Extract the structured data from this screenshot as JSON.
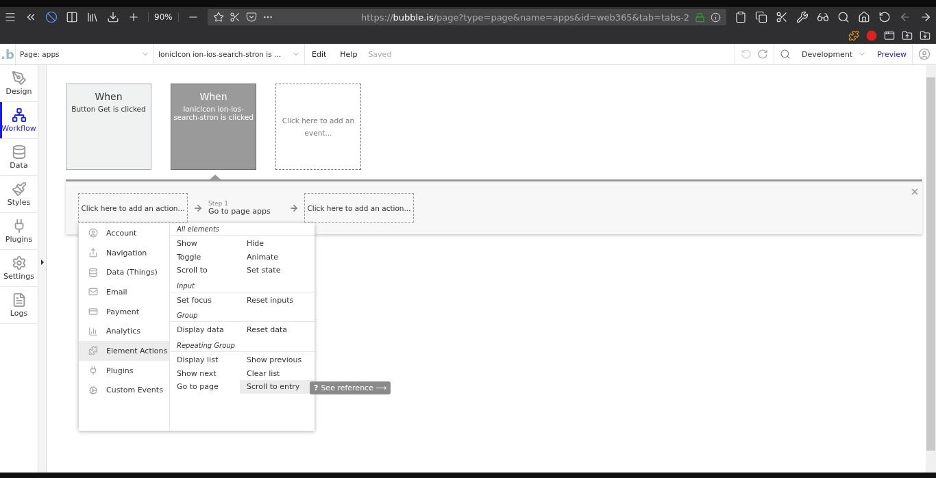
{
  "browser": {
    "zoom": "90%",
    "url_prefix": "https://",
    "url_host": "bubble.is",
    "url_path": "/page?type=page&name=apps&id=web365&tab=tabs-2"
  },
  "header": {
    "logo": ".b",
    "page_selector": "Page: apps",
    "element_selector": "IonicIcon ion-ios-search-stron is ...",
    "menu": [
      "Edit",
      "Help"
    ],
    "status": "Saved",
    "environment": "Development",
    "preview": "Preview"
  },
  "sidebar": {
    "items": [
      {
        "label": "Design",
        "selected": false
      },
      {
        "label": "Workflow",
        "selected": true
      },
      {
        "label": "Data",
        "selected": false
      },
      {
        "label": "Styles",
        "selected": false
      },
      {
        "label": "Plugins",
        "selected": false
      },
      {
        "label": "Settings",
        "selected": false
      },
      {
        "label": "Logs",
        "selected": false
      }
    ]
  },
  "events": [
    {
      "kind": "event",
      "title": "When",
      "description": "Button Get is clicked",
      "selected": false
    },
    {
      "kind": "event",
      "title": "When",
      "description": "IonicIcon ion-ios-search-stron is clicked",
      "selected": true
    },
    {
      "kind": "placeholder",
      "description": "Click here to add an event..."
    }
  ],
  "actions": [
    {
      "kind": "placeholder",
      "text": "Click here to add an action..."
    },
    {
      "kind": "step",
      "step": "Step 1",
      "text": "Go to page apps"
    },
    {
      "kind": "placeholder",
      "text": "Click here to add an action..."
    }
  ],
  "action_menu": {
    "categories": [
      {
        "label": "Account",
        "selected": false
      },
      {
        "label": "Navigation",
        "selected": false
      },
      {
        "label": "Data (Things)",
        "selected": false
      },
      {
        "label": "Email",
        "selected": false
      },
      {
        "label": "Payment",
        "selected": false
      },
      {
        "label": "Analytics",
        "selected": false
      },
      {
        "label": "Element Actions",
        "selected": true
      },
      {
        "label": "Plugins",
        "selected": false
      },
      {
        "label": "Custom Events",
        "selected": false
      }
    ],
    "sections": [
      {
        "title": "All elements",
        "items": [
          {
            "label": "Show",
            "highlighted": false
          },
          {
            "label": "Hide",
            "highlighted": false
          },
          {
            "label": "Toggle",
            "highlighted": false
          },
          {
            "label": "Animate",
            "highlighted": false
          },
          {
            "label": "Scroll to",
            "highlighted": false
          },
          {
            "label": "Set state",
            "highlighted": false
          }
        ]
      },
      {
        "title": "Input",
        "items": [
          {
            "label": "Set focus",
            "highlighted": false
          },
          {
            "label": "Reset inputs",
            "highlighted": false
          }
        ]
      },
      {
        "title": "Group",
        "items": [
          {
            "label": "Display data",
            "highlighted": false
          },
          {
            "label": "Reset data",
            "highlighted": false
          }
        ]
      },
      {
        "title": "Repeating Group",
        "items": [
          {
            "label": "Display list",
            "highlighted": false
          },
          {
            "label": "Show previous",
            "highlighted": false
          },
          {
            "label": "Show next",
            "highlighted": false
          },
          {
            "label": "Clear list",
            "highlighted": false
          },
          {
            "label": "Go to page",
            "highlighted": false
          },
          {
            "label": "Scroll to entry",
            "highlighted": true
          }
        ]
      }
    ],
    "tooltip": {
      "icon": "?",
      "text": "See reference ⟶"
    }
  }
}
